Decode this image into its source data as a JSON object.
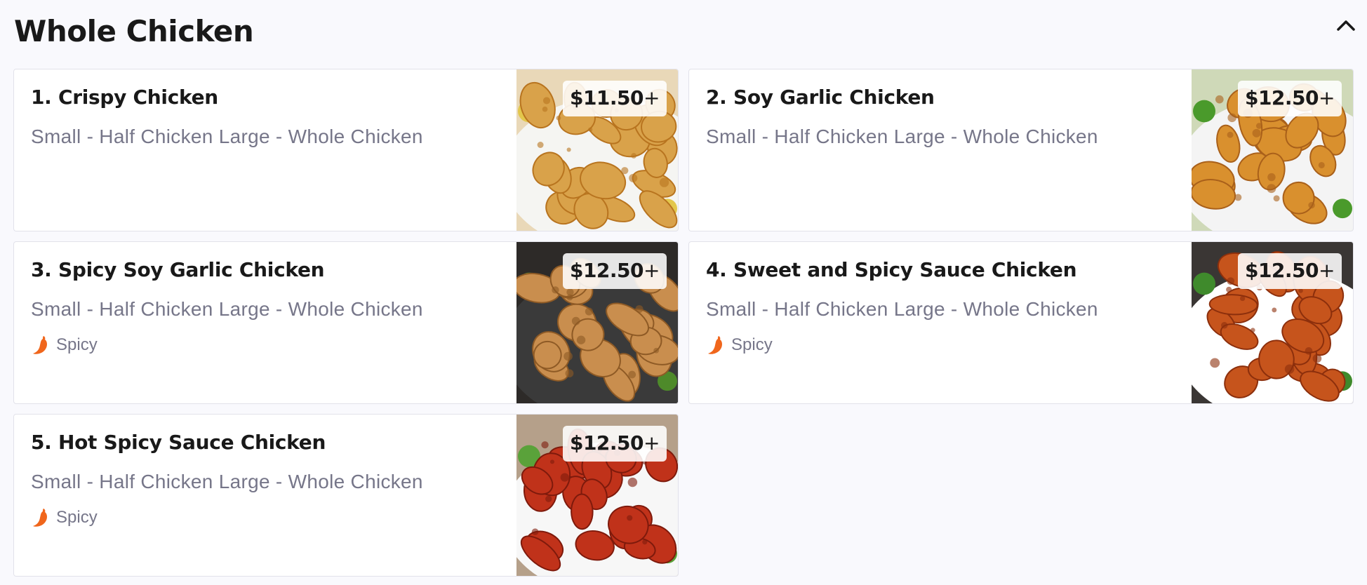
{
  "section": {
    "title": "Whole Chicken",
    "collapse_icon": "chevron-up-icon"
  },
  "items": [
    {
      "name": "1. Crispy Chicken",
      "description": "Small - Half Chicken Large - Whole Chicken",
      "price": "$11.50",
      "price_suffix": "+",
      "spicy": false,
      "spicy_label": "",
      "image": {
        "plate": "#f5f5f2",
        "food": "#d9a24a",
        "accent": "#b8741f",
        "bg": "#e9d8b8",
        "garnish": "#e3c74c"
      }
    },
    {
      "name": "2. Soy Garlic Chicken",
      "description": "Small - Half Chicken Large - Whole Chicken",
      "price": "$12.50",
      "price_suffix": "+",
      "spicy": false,
      "spicy_label": "",
      "image": {
        "plate": "#f4f4f4",
        "food": "#d9902e",
        "accent": "#a9601a",
        "bg": "#cfd9b8",
        "garnish": "#4a9a2b"
      }
    },
    {
      "name": "3. Spicy Soy Garlic Chicken",
      "description": "Small - Half Chicken Large - Whole Chicken",
      "price": "$12.50",
      "price_suffix": "+",
      "spicy": true,
      "spicy_label": "Spicy",
      "image": {
        "plate": "#3a3a3a",
        "food": "#c98e4e",
        "accent": "#8e5a25",
        "bg": "#2d2a28",
        "garnish": "#4e8a2a"
      }
    },
    {
      "name": "4. Sweet and Spicy Sauce Chicken",
      "description": "Small - Half Chicken Large - Whole Chicken",
      "price": "$12.50",
      "price_suffix": "+",
      "spicy": true,
      "spicy_label": "Spicy",
      "image": {
        "plate": "#ffffff",
        "food": "#c6541c",
        "accent": "#8c2f0c",
        "bg": "#3a3634",
        "garnish": "#3f8a2c"
      }
    },
    {
      "name": "5. Hot Spicy Sauce Chicken",
      "description": "Small - Half Chicken Large - Whole Chicken",
      "price": "$12.50",
      "price_suffix": "+",
      "spicy": true,
      "spicy_label": "Spicy",
      "image": {
        "plate": "#f7f7f7",
        "food": "#c0321a",
        "accent": "#7e1a0c",
        "bg": "#b5a08a",
        "garnish": "#5aa23a"
      }
    }
  ],
  "colors": {
    "spicy_icon": "#f0661c",
    "text_primary": "#191919",
    "text_secondary": "#767689",
    "page_bg": "#f9f9fd"
  }
}
